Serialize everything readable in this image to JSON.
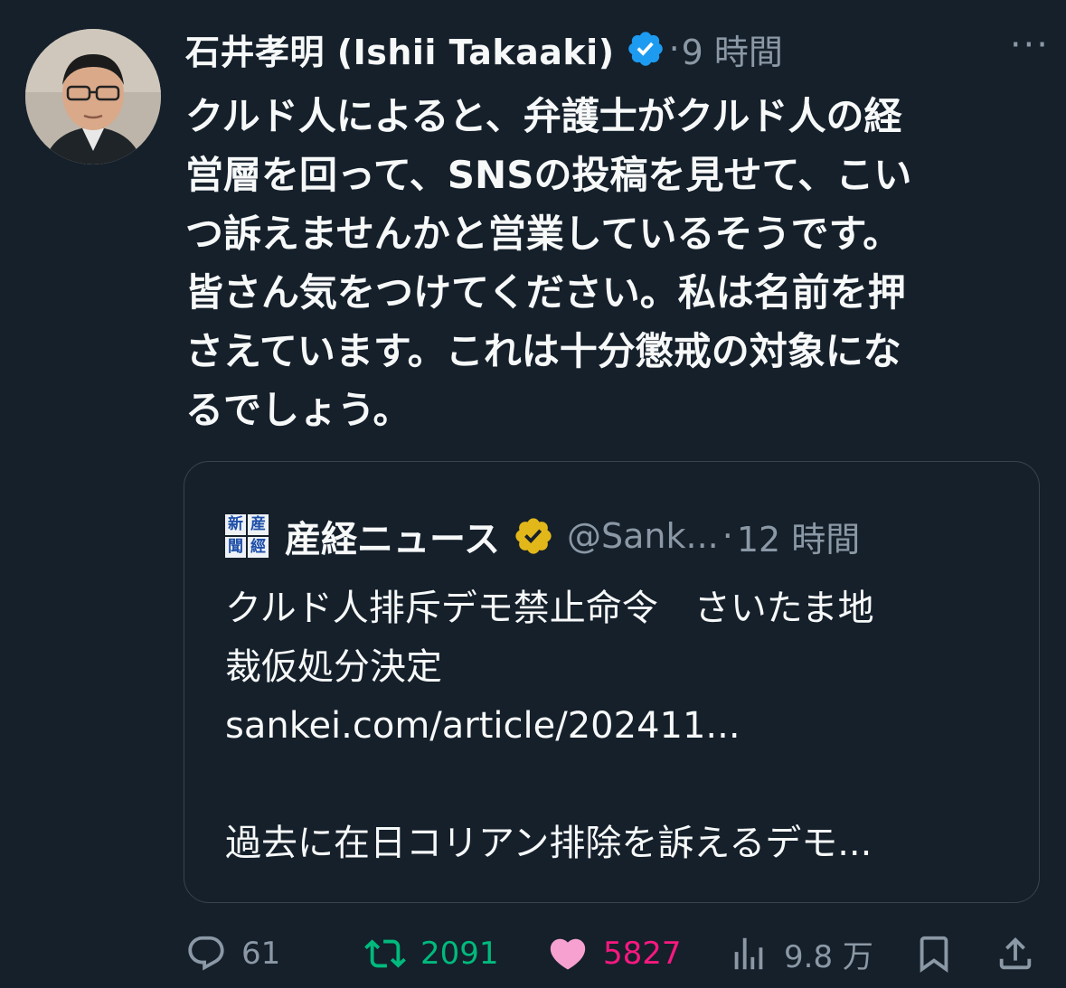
{
  "post": {
    "author_name": "石井孝明 (Ishii Takaaki)",
    "separator": "·",
    "time": "9 時間",
    "more": "···",
    "text": "クルド人によると、弁護士がクルド人の経\n営層を回って、SNSの投稿を見せて、こい\nつ訴えませんかと営業しているそうです。\n皆さん気をつけてください。私は名前を押\nさえています。これは十分懲戒の対象にな\nるでしょう。"
  },
  "quote": {
    "logo_chars": [
      "産",
      "經",
      "新",
      "聞"
    ],
    "author_name": "産経ニュース",
    "handle": "@Sank...",
    "separator": "·",
    "time": "12 時間",
    "text": "クルド人排斥デモ禁止命令　さいたま地\n裁仮処分決定\nsankei.com/article/202411...\n\n過去に在日コリアン排除を訴えるデモ..."
  },
  "actions": {
    "replies": "61",
    "reposts": "2091",
    "likes": "5827",
    "views": "9.8 万"
  },
  "colors": {
    "background": "#15202b",
    "text": "#f7f9f9",
    "muted": "#8b98a5",
    "verified_blue": "#1d9bf0",
    "verified_gold": "#e2b719",
    "repost_green": "#00ba7c",
    "like_pink": "#f91880"
  },
  "icons": [
    "verified-badge-icon",
    "gold-verified-badge-icon",
    "more-icon",
    "reply-icon",
    "repost-icon",
    "like-icon",
    "views-icon",
    "bookmark-icon",
    "share-icon"
  ]
}
